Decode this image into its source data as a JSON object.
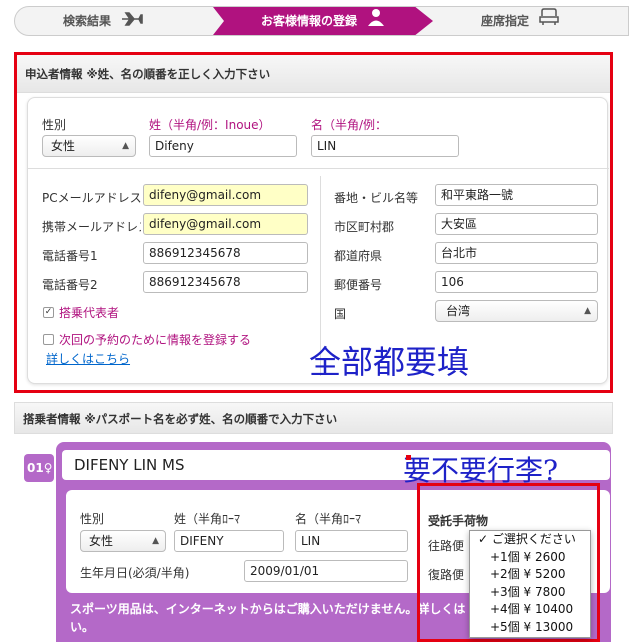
{
  "steps": [
    {
      "label": "検索結果",
      "icon": "airplane-icon"
    },
    {
      "label": "お客様情報の登録",
      "icon": "person-icon"
    },
    {
      "label": "座席指定",
      "icon": "seat-icon"
    }
  ],
  "applicant": {
    "heading": "申込者情報 ※姓、名の順番を正しく入力下さい",
    "gender_label": "性別",
    "gender_value": "女性",
    "surname_label": "姓（半角/例：Inoue）",
    "surname_value": "Difeny",
    "given_label": "名（半角/例：",
    "given_value": "LIN",
    "pc_mail_label": "PCメールアドレス",
    "pc_mail_value": "difeny@gmail.com",
    "mobile_mail_label": "携帯メールアドレス",
    "mobile_mail_value": "difeny@gmail.com",
    "phone1_label": "電話番号1",
    "phone1_value": "886912345678",
    "phone2_label": "電話番号2",
    "phone2_value": "886912345678",
    "representative_label": "搭乗代表者",
    "save_info_label": "次回の予約のために情報を登録する",
    "details_link": "詳しくはこちら",
    "address_label": "番地・ビル名等",
    "address_value": "和平東路一號",
    "city_label": "市区町村郡",
    "city_value": "大安區",
    "prefecture_label": "都道府県",
    "prefecture_value": "台北市",
    "postal_label": "郵便番号",
    "postal_value": "106",
    "country_label": "国",
    "country_value": "台湾"
  },
  "annotations": {
    "all_required": "全部都要填",
    "luggage_question": "要不要行李?"
  },
  "passenger": {
    "heading": "搭乗者情報 ※パスポート名を必ず姓、名の順番で入力下さい",
    "number": "01",
    "full_name": "DIFENY LIN MS",
    "gender_label": "性別",
    "gender_value": "女性",
    "surname_label": "姓（半角ﾛｰﾏ",
    "surname_value": "DIFENY",
    "given_label": "名（半角ﾛｰﾏ",
    "given_value": "LIN",
    "birth_label": "生年月日(必須/半角)",
    "birth_value": "2009/01/01",
    "baggage_label": "受託手荷物",
    "outbound_label": "往路便",
    "return_label": "復路便",
    "warning": "スポーツ用品は、インターネットからはご購入いただけません。詳しくは",
    "warning2": "い。"
  },
  "baggage_options": [
    "✓ ご選択ください",
    "+1個 ¥ 2600",
    "+2個 ¥ 5200",
    "+3個 ¥ 7800",
    "+4個 ¥ 10400",
    "+5個 ¥ 13000"
  ],
  "colors": {
    "brand": "#b0127f",
    "passenger_bg": "#b469c8",
    "highlight_red": "#e50012",
    "annotation_blue": "#1e22c8"
  }
}
